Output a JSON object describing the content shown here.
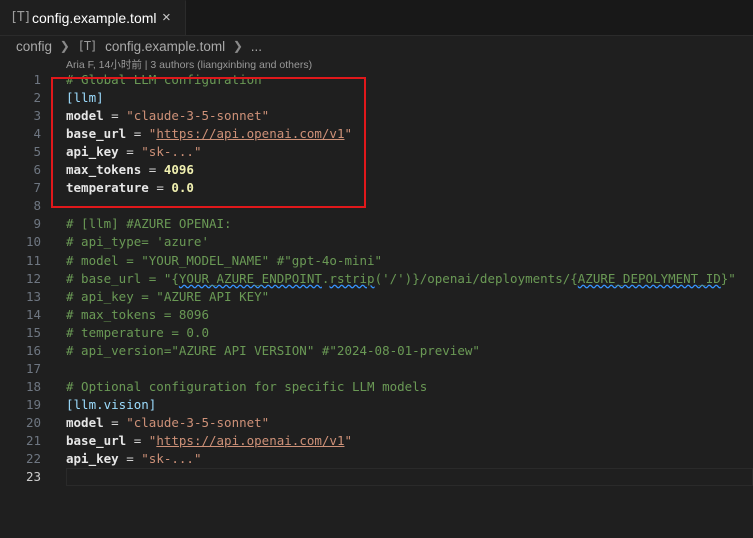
{
  "tab": {
    "icon": "[T]",
    "label": "config.example.toml",
    "close": "×"
  },
  "breadcrumb": {
    "folder": "config",
    "file_icon": "[T]",
    "file": "config.example.toml",
    "more": "..."
  },
  "blame": "Aria F, 14小时前 | 3 authors (liangxinbing and others)",
  "colors": {
    "highlight_box": "#e0181b",
    "comment": "#6a9955",
    "string": "#ce9178",
    "background": "#1f1f1f"
  },
  "lines": [
    {
      "n": "1",
      "parts": [
        {
          "t": "# Global LLM configuration",
          "c": "comment"
        }
      ]
    },
    {
      "n": "2",
      "parts": [
        {
          "t": "[llm]",
          "c": "section"
        }
      ]
    },
    {
      "n": "3",
      "parts": [
        {
          "t": "model",
          "c": "key"
        },
        {
          "t": " = ",
          "c": "op"
        },
        {
          "t": "\"claude-3-5-sonnet\"",
          "c": "str"
        }
      ]
    },
    {
      "n": "4",
      "parts": [
        {
          "t": "base_url",
          "c": "key"
        },
        {
          "t": " = ",
          "c": "op"
        },
        {
          "t": "\"",
          "c": "str"
        },
        {
          "t": "https://api.openai.com/v1",
          "c": "url"
        },
        {
          "t": "\"",
          "c": "str"
        }
      ]
    },
    {
      "n": "5",
      "parts": [
        {
          "t": "api_key",
          "c": "key"
        },
        {
          "t": " = ",
          "c": "op"
        },
        {
          "t": "\"sk-...\"",
          "c": "str"
        }
      ]
    },
    {
      "n": "6",
      "parts": [
        {
          "t": "max_tokens",
          "c": "key"
        },
        {
          "t": " = ",
          "c": "op"
        },
        {
          "t": "4096",
          "c": "num"
        }
      ]
    },
    {
      "n": "7",
      "parts": [
        {
          "t": "temperature",
          "c": "key"
        },
        {
          "t": " = ",
          "c": "op"
        },
        {
          "t": "0.0",
          "c": "num"
        }
      ]
    },
    {
      "n": "8",
      "parts": []
    },
    {
      "n": "9",
      "parts": [
        {
          "t": "# [llm] #AZURE OPENAI:",
          "c": "comment"
        }
      ]
    },
    {
      "n": "10",
      "parts": [
        {
          "t": "# api_type= 'azure'",
          "c": "comment"
        }
      ]
    },
    {
      "n": "11",
      "parts": [
        {
          "t": "# model = \"YOUR_MODEL_NAME\" #\"gpt-4o-mini\"",
          "c": "comment"
        }
      ]
    },
    {
      "n": "12",
      "parts": [
        {
          "t": "# base_url = \"{",
          "c": "comment"
        },
        {
          "t": "YOUR_AZURE_ENDPOINT",
          "c": "comment-sq"
        },
        {
          "t": ".",
          "c": "comment"
        },
        {
          "t": "rstrip",
          "c": "comment-sq"
        },
        {
          "t": "('/')}/openai/deployments/{",
          "c": "comment"
        },
        {
          "t": "AZURE_DEPOLYMENT_ID",
          "c": "comment-sq"
        },
        {
          "t": "}\"",
          "c": "comment"
        }
      ]
    },
    {
      "n": "13",
      "parts": [
        {
          "t": "# api_key = \"AZURE API KEY\"",
          "c": "comment"
        }
      ]
    },
    {
      "n": "14",
      "parts": [
        {
          "t": "# max_tokens = 8096",
          "c": "comment"
        }
      ]
    },
    {
      "n": "15",
      "parts": [
        {
          "t": "# temperature = 0.0",
          "c": "comment"
        }
      ]
    },
    {
      "n": "16",
      "parts": [
        {
          "t": "# api_version=\"AZURE API VERSION\" #\"2024-08-01-preview\"",
          "c": "comment"
        }
      ]
    },
    {
      "n": "17",
      "parts": []
    },
    {
      "n": "18",
      "parts": [
        {
          "t": "# Optional configuration for specific LLM models",
          "c": "comment"
        }
      ]
    },
    {
      "n": "19",
      "parts": [
        {
          "t": "[llm.vision]",
          "c": "section"
        }
      ]
    },
    {
      "n": "20",
      "parts": [
        {
          "t": "model",
          "c": "key"
        },
        {
          "t": " = ",
          "c": "op"
        },
        {
          "t": "\"claude-3-5-sonnet\"",
          "c": "str"
        }
      ]
    },
    {
      "n": "21",
      "parts": [
        {
          "t": "base_url",
          "c": "key"
        },
        {
          "t": " = ",
          "c": "op"
        },
        {
          "t": "\"",
          "c": "str"
        },
        {
          "t": "https://api.openai.com/v1",
          "c": "url"
        },
        {
          "t": "\"",
          "c": "str"
        }
      ]
    },
    {
      "n": "22",
      "parts": [
        {
          "t": "api_key",
          "c": "key"
        },
        {
          "t": " = ",
          "c": "op"
        },
        {
          "t": "\"sk-...\"",
          "c": "str"
        }
      ]
    },
    {
      "n": "23",
      "parts": [],
      "active": true
    }
  ]
}
